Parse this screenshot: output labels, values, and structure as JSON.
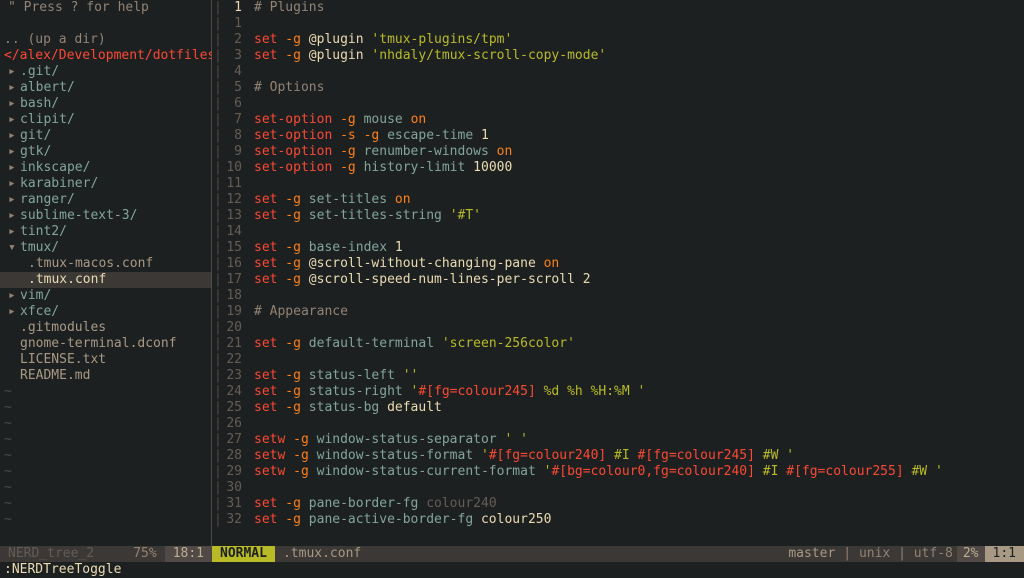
{
  "sidebar": {
    "help": "\" Press ? for help",
    "updir": ".. (up a dir)",
    "path": "</alex/Development/dotfiles/",
    "items": [
      {
        "arrow": "▸",
        "label": ".git/",
        "type": "dir"
      },
      {
        "arrow": "▸",
        "label": "albert/",
        "type": "dir"
      },
      {
        "arrow": "▸",
        "label": "bash/",
        "type": "dir"
      },
      {
        "arrow": "▸",
        "label": "clipit/",
        "type": "dir"
      },
      {
        "arrow": "▸",
        "label": "git/",
        "type": "dir"
      },
      {
        "arrow": "▸",
        "label": "gtk/",
        "type": "dir"
      },
      {
        "arrow": "▸",
        "label": "inkscape/",
        "type": "dir"
      },
      {
        "arrow": "▸",
        "label": "karabiner/",
        "type": "dir"
      },
      {
        "arrow": "▸",
        "label": "ranger/",
        "type": "dir"
      },
      {
        "arrow": "▸",
        "label": "sublime-text-3/",
        "type": "dir"
      },
      {
        "arrow": "▸",
        "label": "tint2/",
        "type": "dir"
      },
      {
        "arrow": "▾",
        "label": "tmux/",
        "type": "dir",
        "expanded": true
      },
      {
        "label": ".tmux-macos.conf",
        "type": "file",
        "nested": true
      },
      {
        "label": ".tmux.conf",
        "type": "file",
        "nested": true,
        "selected": true
      },
      {
        "arrow": "▸",
        "label": "vim/",
        "type": "dir"
      },
      {
        "arrow": "▸",
        "label": "xfce/",
        "type": "dir"
      },
      {
        "label": ".gitmodules",
        "type": "file"
      },
      {
        "label": "gnome-terminal.dconf",
        "type": "file"
      },
      {
        "label": "LICENSE.txt",
        "type": "file"
      },
      {
        "label": "README.md",
        "type": "file"
      }
    ]
  },
  "editor": {
    "current_line_display": "1",
    "lines": [
      {
        "num": "",
        "tokens": [
          {
            "t": "# Plugins",
            "c": "c-comment"
          }
        ],
        "current": true
      },
      {
        "num": "1",
        "tokens": []
      },
      {
        "num": "2",
        "tokens": [
          {
            "t": "set",
            "c": "c-keyword"
          },
          {
            "t": " -g ",
            "c": "c-option"
          },
          {
            "t": "@plugin ",
            "c": "c-default"
          },
          {
            "t": "'tmux-plugins/tpm'",
            "c": "c-string"
          }
        ]
      },
      {
        "num": "3",
        "tokens": [
          {
            "t": "set",
            "c": "c-keyword"
          },
          {
            "t": " -g ",
            "c": "c-option"
          },
          {
            "t": "@plugin ",
            "c": "c-default"
          },
          {
            "t": "'nhdaly/tmux-scroll-copy-mode'",
            "c": "c-string"
          }
        ]
      },
      {
        "num": "4",
        "tokens": []
      },
      {
        "num": "5",
        "tokens": [
          {
            "t": "# Options",
            "c": "c-comment"
          }
        ]
      },
      {
        "num": "6",
        "tokens": []
      },
      {
        "num": "7",
        "tokens": [
          {
            "t": "set-option",
            "c": "c-keyword"
          },
          {
            "t": " -g ",
            "c": "c-option"
          },
          {
            "t": "mouse ",
            "c": "c-param"
          },
          {
            "t": "on",
            "c": "c-value"
          }
        ]
      },
      {
        "num": "8",
        "tokens": [
          {
            "t": "set-option",
            "c": "c-keyword"
          },
          {
            "t": " -s -g ",
            "c": "c-option"
          },
          {
            "t": "escape-time ",
            "c": "c-param"
          },
          {
            "t": "1",
            "c": "c-default"
          }
        ]
      },
      {
        "num": "9",
        "tokens": [
          {
            "t": "set-option",
            "c": "c-keyword"
          },
          {
            "t": " -g ",
            "c": "c-option"
          },
          {
            "t": "renumber-windows ",
            "c": "c-param"
          },
          {
            "t": "on",
            "c": "c-value"
          }
        ]
      },
      {
        "num": "10",
        "tokens": [
          {
            "t": "set-option",
            "c": "c-keyword"
          },
          {
            "t": " -g ",
            "c": "c-option"
          },
          {
            "t": "history-limit ",
            "c": "c-param"
          },
          {
            "t": "10000",
            "c": "c-default"
          }
        ]
      },
      {
        "num": "11",
        "tokens": []
      },
      {
        "num": "12",
        "tokens": [
          {
            "t": "set",
            "c": "c-keyword"
          },
          {
            "t": " -g ",
            "c": "c-option"
          },
          {
            "t": "set-titles ",
            "c": "c-param"
          },
          {
            "t": "on",
            "c": "c-value"
          }
        ]
      },
      {
        "num": "13",
        "tokens": [
          {
            "t": "set",
            "c": "c-keyword"
          },
          {
            "t": " -g ",
            "c": "c-option"
          },
          {
            "t": "set-titles-string ",
            "c": "c-param"
          },
          {
            "t": "'#T'",
            "c": "c-string"
          }
        ]
      },
      {
        "num": "14",
        "tokens": []
      },
      {
        "num": "15",
        "tokens": [
          {
            "t": "set",
            "c": "c-keyword"
          },
          {
            "t": " -g ",
            "c": "c-option"
          },
          {
            "t": "base-index ",
            "c": "c-param"
          },
          {
            "t": "1",
            "c": "c-default"
          }
        ]
      },
      {
        "num": "16",
        "tokens": [
          {
            "t": "set",
            "c": "c-keyword"
          },
          {
            "t": " -g ",
            "c": "c-option"
          },
          {
            "t": "@scroll-without-changing-pane ",
            "c": "c-default"
          },
          {
            "t": "on",
            "c": "c-value"
          }
        ]
      },
      {
        "num": "17",
        "tokens": [
          {
            "t": "set",
            "c": "c-keyword"
          },
          {
            "t": " -g ",
            "c": "c-option"
          },
          {
            "t": "@scroll-speed-num-lines-per-scroll ",
            "c": "c-default"
          },
          {
            "t": "2",
            "c": "c-default"
          }
        ]
      },
      {
        "num": "18",
        "tokens": []
      },
      {
        "num": "19",
        "tokens": [
          {
            "t": "# Appearance",
            "c": "c-comment"
          }
        ]
      },
      {
        "num": "20",
        "tokens": []
      },
      {
        "num": "21",
        "tokens": [
          {
            "t": "set",
            "c": "c-keyword"
          },
          {
            "t": " -g ",
            "c": "c-option"
          },
          {
            "t": "default-terminal ",
            "c": "c-param"
          },
          {
            "t": "'screen-256color'",
            "c": "c-string"
          }
        ]
      },
      {
        "num": "22",
        "tokens": []
      },
      {
        "num": "23",
        "tokens": [
          {
            "t": "set",
            "c": "c-keyword"
          },
          {
            "t": " -g ",
            "c": "c-option"
          },
          {
            "t": "status-left ",
            "c": "c-param"
          },
          {
            "t": "''",
            "c": "c-string"
          }
        ]
      },
      {
        "num": "24",
        "tokens": [
          {
            "t": "set",
            "c": "c-keyword"
          },
          {
            "t": " -g ",
            "c": "c-option"
          },
          {
            "t": "status-right ",
            "c": "c-param"
          },
          {
            "t": "'",
            "c": "c-string"
          },
          {
            "t": "#[fg=colour245]",
            "c": "c-var"
          },
          {
            "t": " %d %h %H:%M ",
            "c": "c-string"
          },
          {
            "t": "'",
            "c": "c-string"
          }
        ]
      },
      {
        "num": "25",
        "tokens": [
          {
            "t": "set",
            "c": "c-keyword"
          },
          {
            "t": " -g ",
            "c": "c-option"
          },
          {
            "t": "status-bg ",
            "c": "c-param"
          },
          {
            "t": "default",
            "c": "c-default"
          }
        ]
      },
      {
        "num": "26",
        "tokens": []
      },
      {
        "num": "27",
        "tokens": [
          {
            "t": "setw",
            "c": "c-keyword"
          },
          {
            "t": " -g ",
            "c": "c-option"
          },
          {
            "t": "window-status-separator ",
            "c": "c-param"
          },
          {
            "t": "' '",
            "c": "c-string"
          }
        ]
      },
      {
        "num": "28",
        "tokens": [
          {
            "t": "setw",
            "c": "c-keyword"
          },
          {
            "t": " -g ",
            "c": "c-option"
          },
          {
            "t": "window-status-format ",
            "c": "c-param"
          },
          {
            "t": "'",
            "c": "c-string"
          },
          {
            "t": "#[fg=colour240]",
            "c": "c-var"
          },
          {
            "t": " #I ",
            "c": "c-string"
          },
          {
            "t": "#[fg=colour245]",
            "c": "c-var"
          },
          {
            "t": " #W ",
            "c": "c-string"
          },
          {
            "t": "'",
            "c": "c-string"
          }
        ]
      },
      {
        "num": "29",
        "tokens": [
          {
            "t": "setw",
            "c": "c-keyword"
          },
          {
            "t": " -g ",
            "c": "c-option"
          },
          {
            "t": "window-status-current-format ",
            "c": "c-param"
          },
          {
            "t": "'",
            "c": "c-string"
          },
          {
            "t": "#[bg=colour0,fg=colour240]",
            "c": "c-var"
          },
          {
            "t": " #I ",
            "c": "c-string"
          },
          {
            "t": "#[fg=colour255]",
            "c": "c-var"
          },
          {
            "t": " #W ",
            "c": "c-string"
          },
          {
            "t": "'",
            "c": "c-string"
          }
        ]
      },
      {
        "num": "30",
        "tokens": []
      },
      {
        "num": "31",
        "tokens": [
          {
            "t": "set",
            "c": "c-keyword"
          },
          {
            "t": " -g ",
            "c": "c-option"
          },
          {
            "t": "pane-border-fg ",
            "c": "c-param"
          },
          {
            "t": "colour240",
            "c": "c-dim"
          }
        ]
      },
      {
        "num": "32",
        "tokens": [
          {
            "t": "set",
            "c": "c-keyword"
          },
          {
            "t": " -g ",
            "c": "c-option"
          },
          {
            "t": "pane-active-border-fg ",
            "c": "c-param"
          },
          {
            "t": "colour250",
            "c": "c-default"
          }
        ]
      }
    ]
  },
  "status": {
    "tree": {
      "name": "NERD_tree_2",
      "pct": "75%",
      "pos": "18:1"
    },
    "mode": "NORMAL",
    "filename": ".tmux.conf",
    "git": "master",
    "fileinfo": "unix | utf-8",
    "pct": "2%",
    "pos": "1:1"
  },
  "commandline": ":NERDTreeToggle"
}
